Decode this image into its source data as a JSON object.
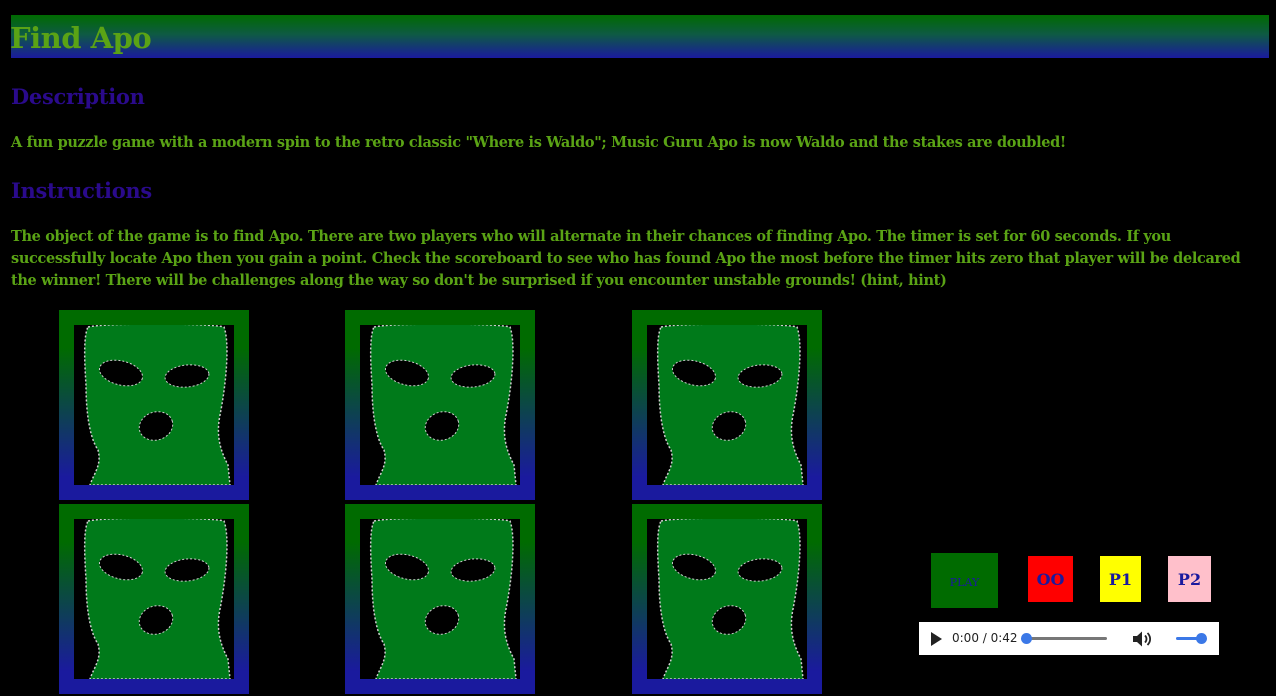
{
  "header": {
    "title": "Find Apo"
  },
  "description": {
    "heading": "Description",
    "text": "A fun puzzle game with a modern spin to the retro classic \"Where is Waldo\"; Music Guru Apo is now Waldo and the stakes are doubled!"
  },
  "instructions": {
    "heading": "Instructions",
    "text": "The object of the game is to find Apo. There are two players who will alternate in their chances of finding Apo. The timer is set for 60 seconds. If you successfully locate Apo then you gain a point. Check the scoreboard to see who has found Apo the most before the timer hits zero that player will be delcared the winner! There will be challenges along the way so don't be surprised if you encounter unstable grounds! (hint, hint)"
  },
  "board": {
    "tiles": [
      {
        "icon": "ski-mask-icon"
      },
      {
        "icon": "ski-mask-icon"
      },
      {
        "icon": "ski-mask-icon"
      },
      {
        "icon": "ski-mask-icon"
      },
      {
        "icon": "ski-mask-icon"
      },
      {
        "icon": "ski-mask-icon"
      }
    ]
  },
  "controls": {
    "play_label": "PLAY",
    "timer_label": "OO",
    "player1_label": "P1",
    "player2_label": "P2"
  },
  "audio": {
    "time": "0:00 / 0:42",
    "progress": 0,
    "volume": 1
  },
  "colors": {
    "title_green": "#5aa315",
    "heading_purple": "#2a0a8c",
    "tile_green": "#006b00",
    "tile_blue": "#1a1a9e",
    "mask_green": "#007a1a",
    "timer_red": "#ff0000",
    "p1_yellow": "#ffff00",
    "p2_pink": "#ffc0cb"
  }
}
